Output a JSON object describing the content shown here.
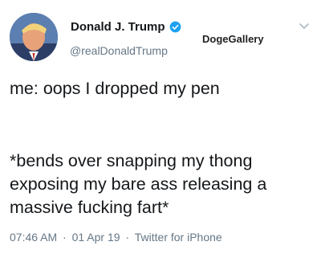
{
  "author": {
    "display_name": "Donald J. Trump",
    "handle": "@realDonaldTrump",
    "verified_icon": "verified-badge-icon"
  },
  "watermark": "DogeGallery",
  "tweet": {
    "line1": "me: oops I dropped my pen",
    "line2": "*bends over snapping my thong exposing my bare ass releasing a massive fucking fart*"
  },
  "meta": {
    "time": "07:46 AM",
    "date": "01 Apr 19",
    "source": "Twitter for iPhone",
    "separator": "·"
  },
  "colors": {
    "verified_blue": "#1da1f2",
    "secondary_text": "#657786",
    "primary_text": "#14171a"
  }
}
